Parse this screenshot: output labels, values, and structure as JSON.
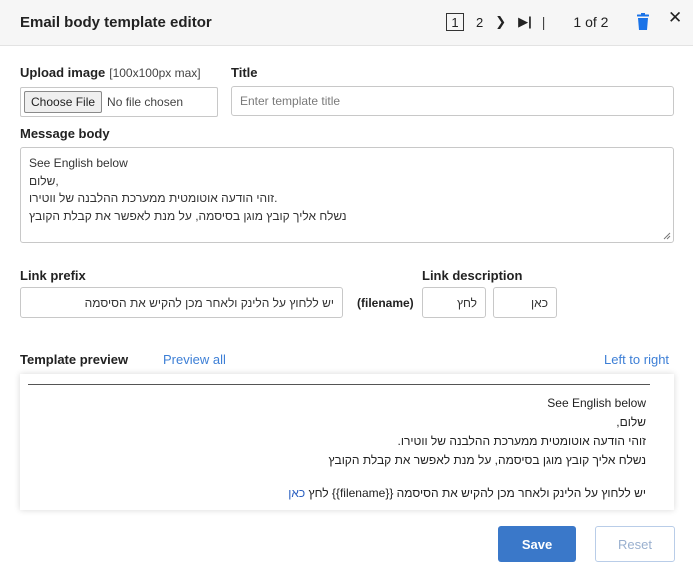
{
  "header": {
    "title": "Email body template editor",
    "pager": {
      "current": "1",
      "next": "2",
      "next_icon": "chevron-right-icon",
      "last_icon": "skip-to-last-icon",
      "separator": "|",
      "of_text": "1 of 2"
    },
    "delete_icon": "trash-icon",
    "close_icon": "close-icon",
    "accent": "#1a73e8"
  },
  "upload": {
    "label": "Upload image",
    "hint": "[100x100px max]",
    "button_label": "Choose File",
    "status": "No file chosen"
  },
  "title_field": {
    "label": "Title",
    "placeholder": "Enter template title"
  },
  "message": {
    "label": "Message body",
    "lines": [
      "See English below",
      "שלום,",
      "זוהי הודעה אוטומטית ממערכת ההלבנה של ווטירו.",
      "נשלח אליך קובץ מוגן בסיסמה, על מנת לאפשר את קבלת הקובץ"
    ]
  },
  "link": {
    "prefix_label": "Link prefix",
    "prefix_value": "יש ללחוץ על הלינק ולאחר מכן להקיש את הסיסמה",
    "filename_token": "(filename)",
    "description_label": "Link description",
    "description_value_1": "לחץ",
    "description_value_2": "כאן"
  },
  "preview": {
    "label": "Template preview",
    "preview_all": "Preview all",
    "direction_toggle": "Left to right",
    "lines": [
      "See English below",
      "שלום,",
      "זוהי הודעה אוטומטית ממערכת ההלבנה של ווטירו.",
      "נשלח אליך קובץ מוגן בסיסמה, על מנת לאפשר את קבלת הקובץ"
    ],
    "link_line_text": "יש ללחוץ על הלינק ולאחר מכן להקיש את הסיסמה {{filename}} לחץ",
    "link_line_link": "כאן"
  },
  "actions": {
    "save": "Save",
    "reset": "Reset",
    "save_color": "#3a78c9"
  }
}
